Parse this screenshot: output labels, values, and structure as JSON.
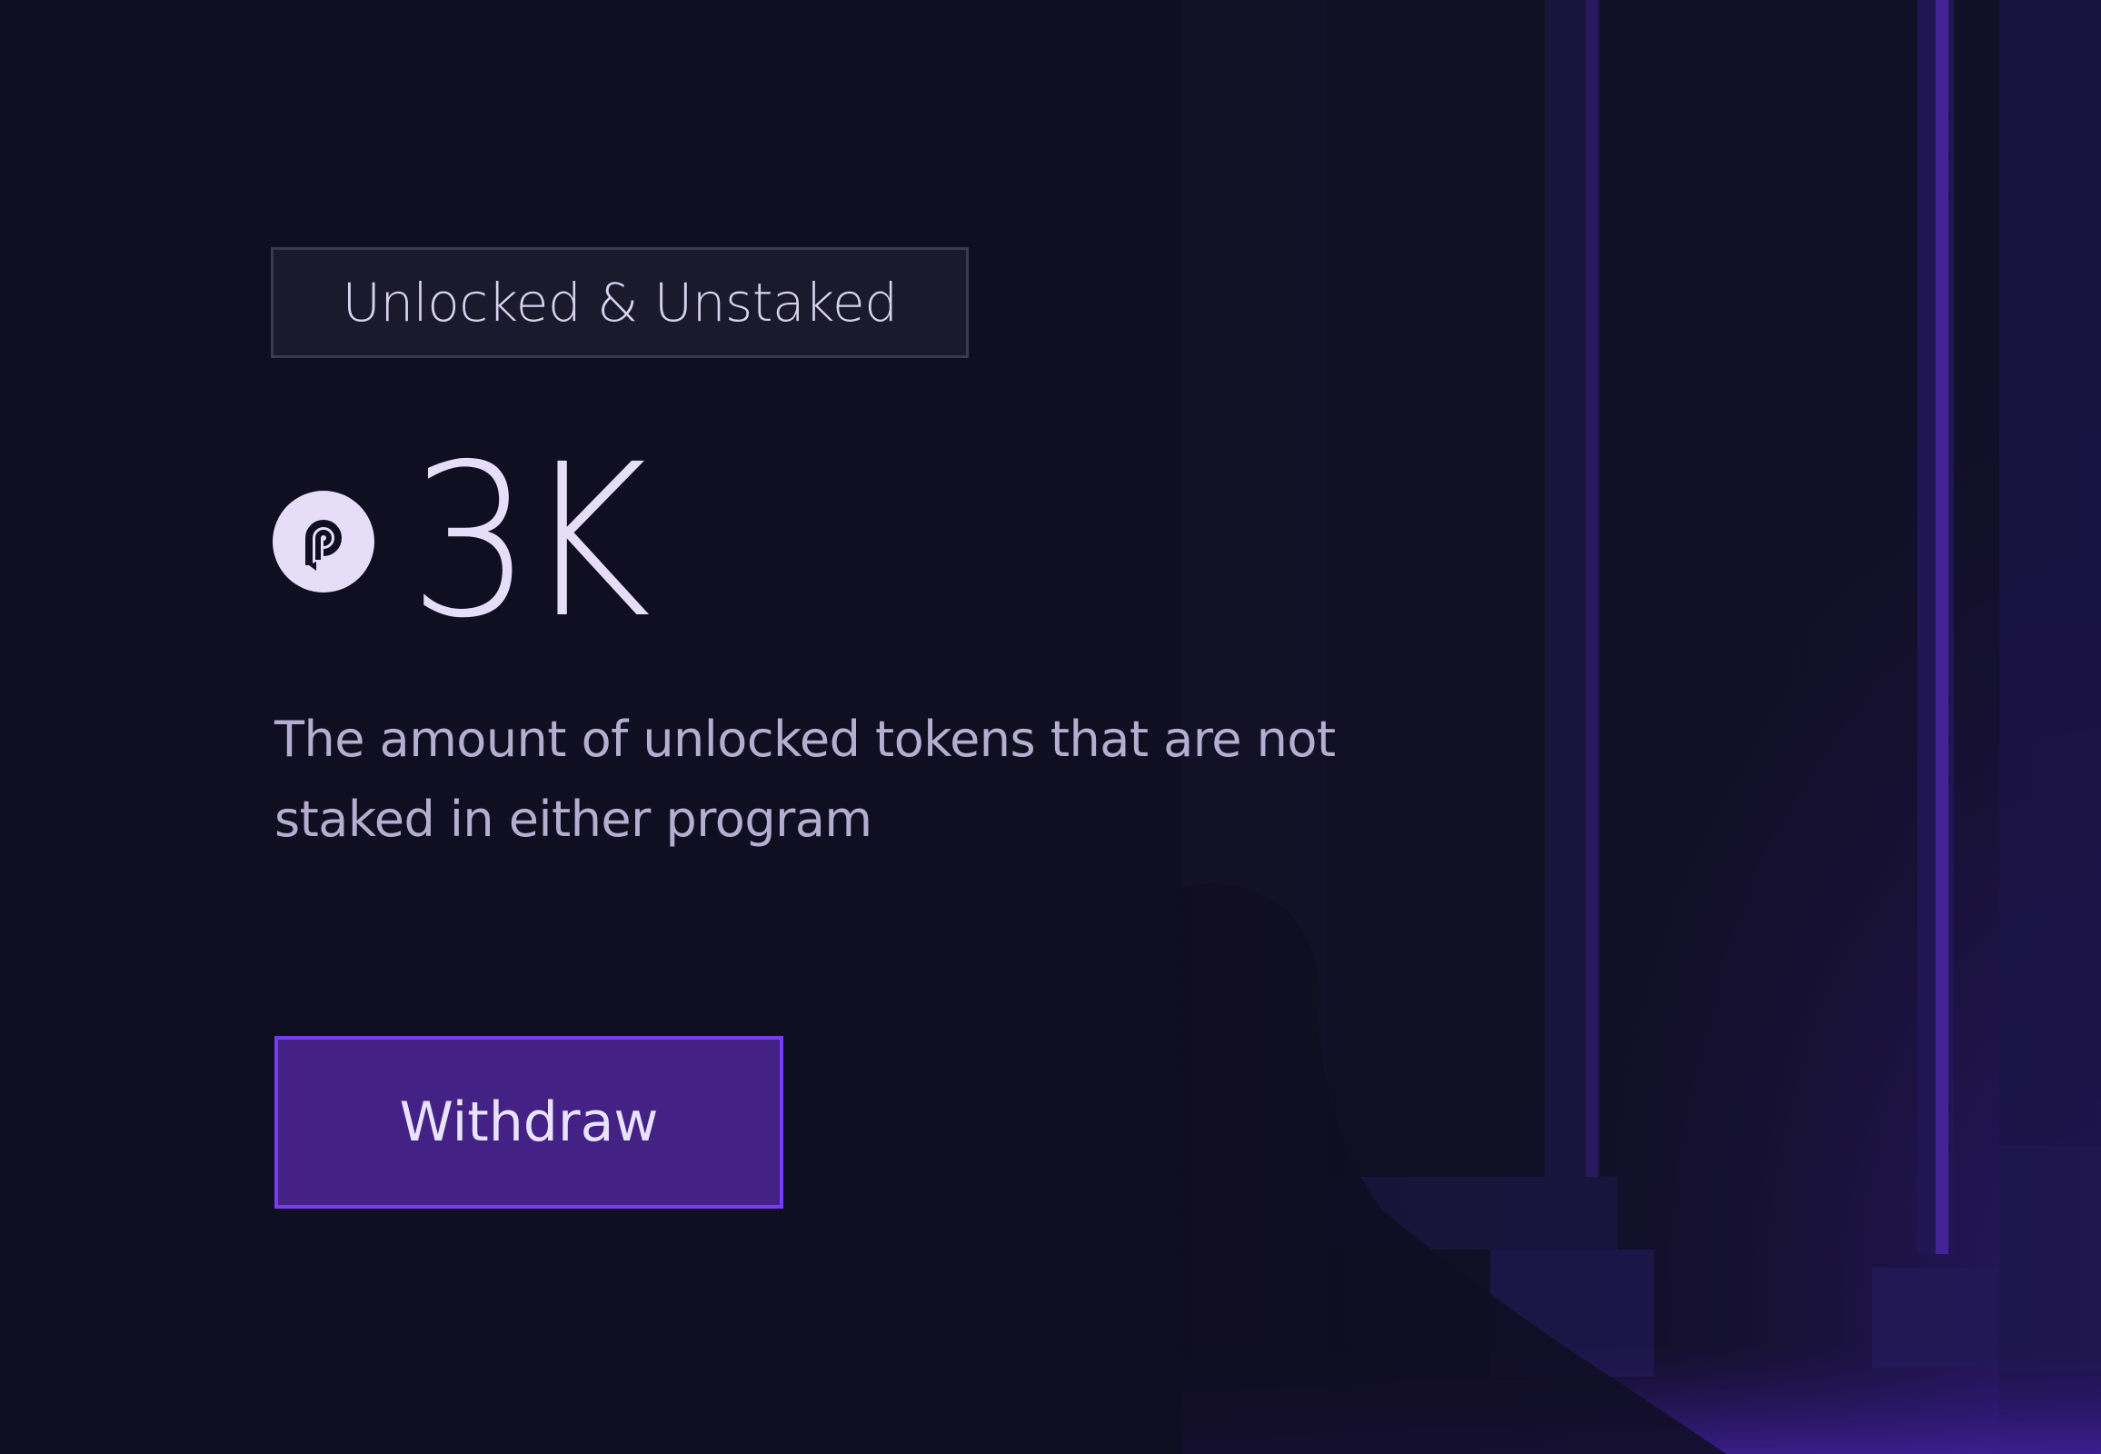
{
  "card": {
    "badge_label": "Unlocked & Unstaked",
    "amount": "3K",
    "token_icon": "pyth-token-icon",
    "description": "The amount of unlocked tokens that are not staked in either program",
    "withdraw_label": "Withdraw"
  },
  "theme": {
    "background": "#100f21",
    "badge_background": "#1b1a2c",
    "badge_border": "#3b3a4d",
    "accent": "#442185",
    "accent_border": "#7a3cf0",
    "text_primary": "#e6def8",
    "text_secondary": "#b6aed0"
  }
}
